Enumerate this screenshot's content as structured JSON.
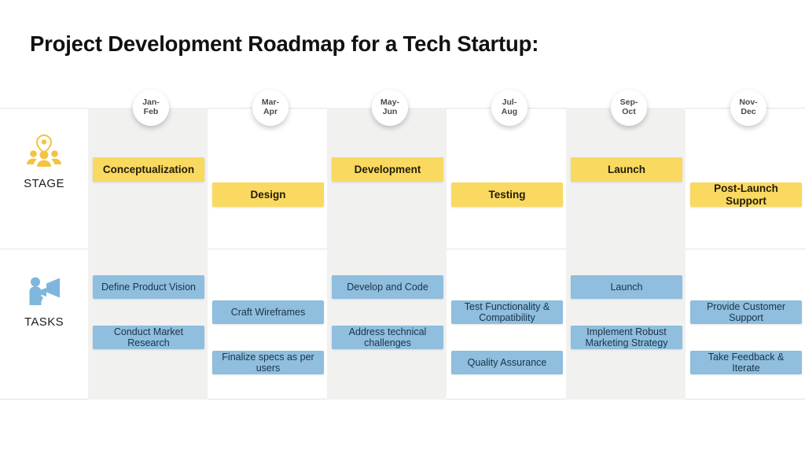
{
  "title": "Project Development Roadmap for a Tech Startup:",
  "colors": {
    "stage_bar": "#fad961",
    "task_bar": "#8fbede",
    "stage_icon": "#f5c342",
    "task_icon": "#7fb6dd",
    "band": "#f1f1f0",
    "title_text": "#111111"
  },
  "rows": [
    {
      "key": "stage",
      "label": "STAGE",
      "icon": "people-group-pin-icon"
    },
    {
      "key": "tasks",
      "label": "TASKS",
      "icon": "person-megaphone-icon"
    }
  ],
  "periods": [
    {
      "line1": "Jan-",
      "line2": "Feb"
    },
    {
      "line1": "Mar-",
      "line2": "Apr"
    },
    {
      "line1": "May-",
      "line2": "Jun"
    },
    {
      "line1": "Jul-",
      "line2": "Aug"
    },
    {
      "line1": "Sep-",
      "line2": "Oct"
    },
    {
      "line1": "Nov-",
      "line2": "Dec"
    }
  ],
  "chart_data": {
    "type": "bar",
    "title": "Project Development Roadmap for a Tech Startup:",
    "xlabel": "",
    "ylabel": "",
    "categories": [
      "Jan-Feb",
      "Mar-Apr",
      "May-Jun",
      "Jul-Aug",
      "Sep-Oct",
      "Nov-Dec"
    ],
    "legend_position": "none",
    "grid": false,
    "series": [
      {
        "name": "STAGE",
        "color": "#fad961",
        "values": [
          "Conceptualization",
          "Design",
          "Development",
          "Testing",
          "Launch",
          "Post-Launch Support"
        ]
      },
      {
        "name": "TASKS",
        "color": "#8fbede",
        "values": [
          [
            "Define Product Vision",
            "Conduct Market Research"
          ],
          [
            "Craft Wireframes",
            "Finalize specs as per users"
          ],
          [
            "Develop and Code",
            "Address technical challenges"
          ],
          [
            "Test Functionality & Compatibility",
            "Quality Assurance"
          ],
          [
            "Launch",
            "Implement Robust Marketing Strategy"
          ],
          [
            "Provide Customer Support",
            "Take Feedback & Iterate"
          ]
        ]
      }
    ]
  },
  "stage_bars": [
    {
      "label": "Conceptualization",
      "period": 0,
      "sub": 0
    },
    {
      "label": "Design",
      "period": 1,
      "sub": 1
    },
    {
      "label": "Development",
      "period": 2,
      "sub": 0
    },
    {
      "label": "Testing",
      "period": 3,
      "sub": 1
    },
    {
      "label": "Launch",
      "period": 4,
      "sub": 0
    },
    {
      "label": "Post-Launch Support",
      "period": 5,
      "sub": 1
    }
  ],
  "task_bars": [
    {
      "label": "Define Product Vision",
      "period": 0,
      "sub": 0
    },
    {
      "label": "Conduct Market Research",
      "period": 0,
      "sub": 2
    },
    {
      "label": "Craft Wireframes",
      "period": 1,
      "sub": 1
    },
    {
      "label": "Finalize specs as per users",
      "period": 1,
      "sub": 3
    },
    {
      "label": "Develop and Code",
      "period": 2,
      "sub": 0
    },
    {
      "label": "Address technical challenges",
      "period": 2,
      "sub": 2
    },
    {
      "label": "Test Functionality & Compatibility",
      "period": 3,
      "sub": 1
    },
    {
      "label": "Quality Assurance",
      "period": 3,
      "sub": 3
    },
    {
      "label": "Launch",
      "period": 4,
      "sub": 0
    },
    {
      "label": "Implement Robust Marketing Strategy",
      "period": 4,
      "sub": 2
    },
    {
      "label": "Provide Customer Support",
      "period": 5,
      "sub": 1
    },
    {
      "label": "Take Feedback & Iterate",
      "period": 5,
      "sub": 3
    }
  ]
}
